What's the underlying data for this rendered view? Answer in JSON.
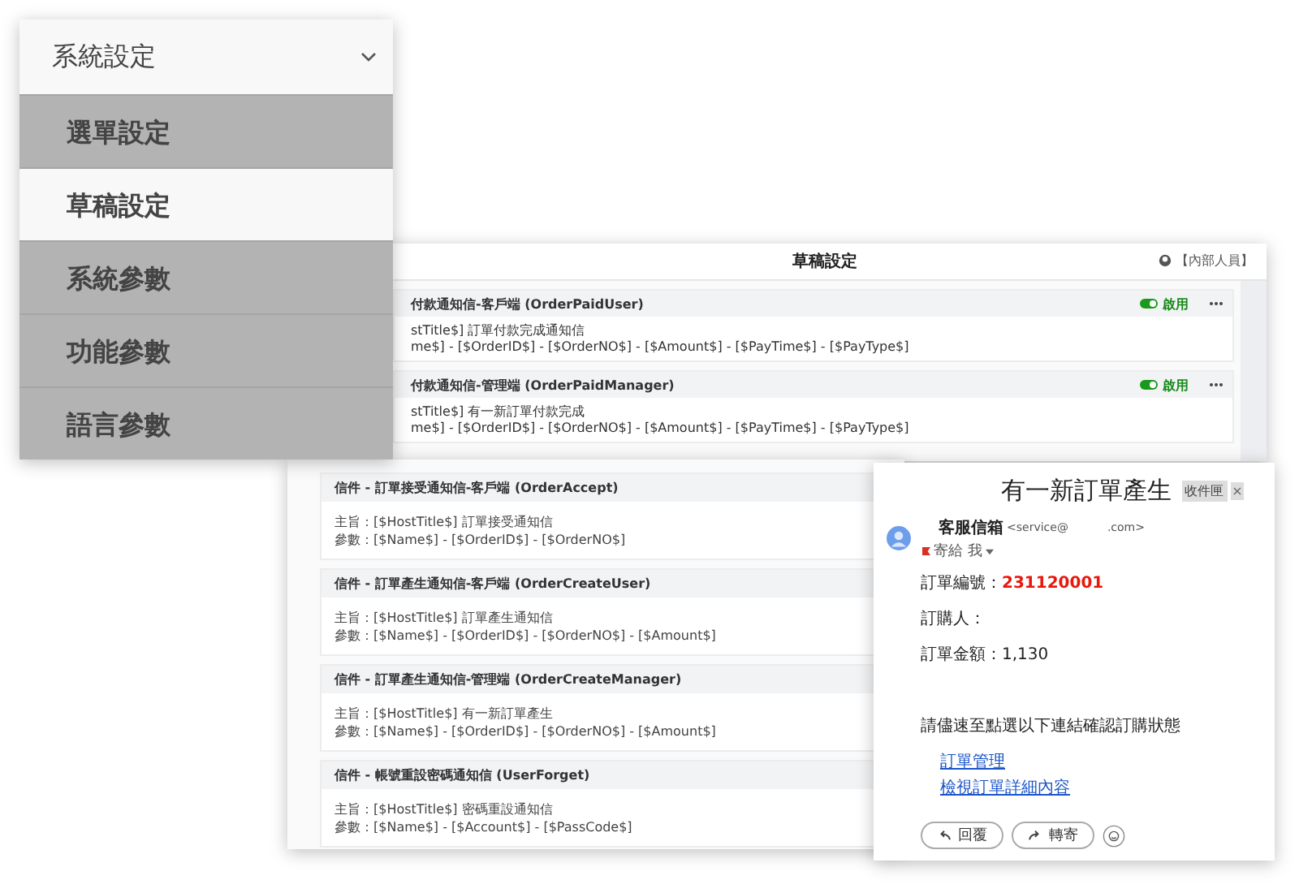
{
  "menu": {
    "title": "系統設定",
    "expanded": true,
    "items": [
      {
        "label": "選單設定",
        "selected": false
      },
      {
        "label": "草稿設定",
        "selected": true
      },
      {
        "label": "系統參數",
        "selected": false
      },
      {
        "label": "功能參數",
        "selected": false
      },
      {
        "label": "語言參數",
        "selected": false
      }
    ]
  },
  "back_window": {
    "title": "草稿設定",
    "user": "【內部人員】",
    "templates": [
      {
        "title": "付款通知信-客戶端 (OrderPaidUser)",
        "subject": "stTitle$] 訂單付款完成通知信",
        "params": "me$] - [$OrderID$] - [$OrderNO$] - [$Amount$] - [$PayTime$] - [$PayType$]",
        "status": "啟用",
        "on": true
      },
      {
        "title": "付款通知信-管理端 (OrderPaidManager)",
        "subject": "stTitle$] 有一新訂單付款完成",
        "params": "me$] - [$OrderID$] - [$OrderNO$] - [$Amount$] - [$PayTime$] - [$PayType$]",
        "status": "啟用",
        "on": true
      }
    ]
  },
  "front_window": {
    "templates": [
      {
        "title": "信件 - 訂單接受通知信-客戶端 (OrderAccept)",
        "subject": "主旨：[$HostTitle$] 訂單接受通知信",
        "params": "參數：[$Name$] - [$OrderID$] - [$OrderNO$]"
      },
      {
        "title": "信件 - 訂單產生通知信-客戶端 (OrderCreateUser)",
        "subject": "主旨：[$HostTitle$] 訂單產生通知信",
        "params": "參數：[$Name$] - [$OrderID$] - [$OrderNO$] - [$Amount$]"
      },
      {
        "title": "信件 - 訂單產生通知信-管理端 (OrderCreateManager)",
        "subject": "主旨：[$HostTitle$] 有一新訂單產生",
        "params": "參數：[$Name$] - [$OrderID$] - [$OrderNO$] - [$Amount$]"
      },
      {
        "title": "信件 - 帳號重設密碼通知信 (UserForget)",
        "subject": "主旨：[$HostTitle$] 密碼重設通知信",
        "params": "參數：[$Name$] - [$Account$] - [$PassCode$]"
      }
    ]
  },
  "email": {
    "subject": "有一新訂單產生",
    "label": "收件匣",
    "label_close": "×",
    "sender_name": "客服信箱",
    "sender_email_start": "<service@",
    "sender_email_end": ".com>",
    "recipient": "寄給 我",
    "fields": [
      {
        "label": "訂單編號：",
        "value": "231120001"
      },
      {
        "label": "訂購人："
      },
      {
        "label": "訂單金額：1,130"
      }
    ],
    "message": "請儘速至點選以下連結確認訂購狀態",
    "links": [
      "訂單管理",
      "檢視訂單詳細內容"
    ],
    "buttons": [
      {
        "label": "回覆",
        "kind": "reply"
      },
      {
        "label": "轉寄",
        "kind": "forward"
      }
    ]
  }
}
